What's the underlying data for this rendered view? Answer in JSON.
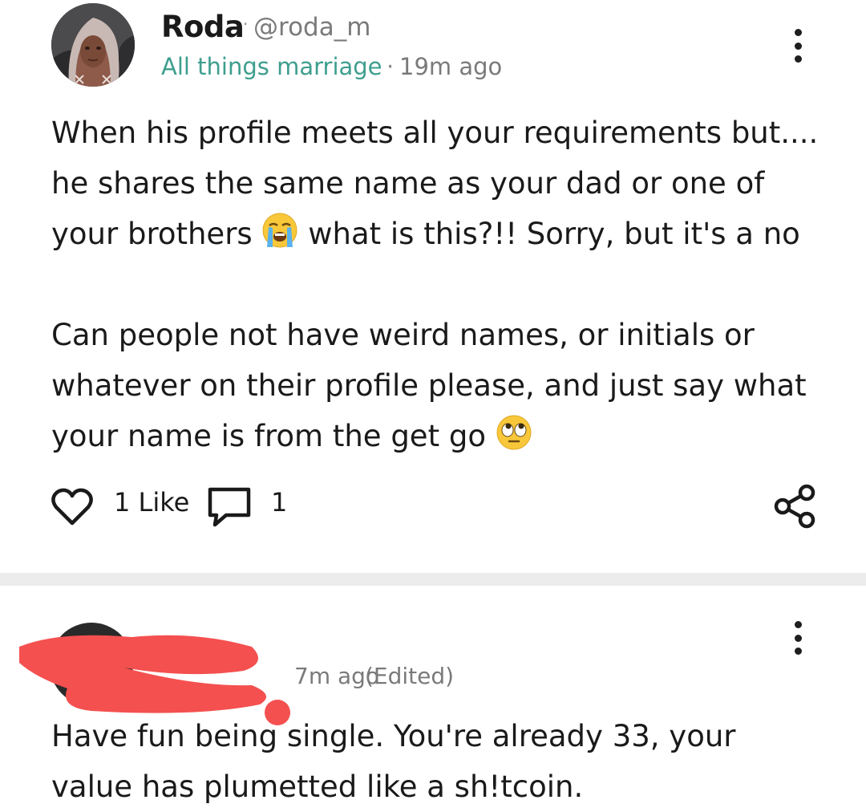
{
  "post": {
    "author": {
      "name": "Roda",
      "separator": "·",
      "handle": "@roda_m"
    },
    "group": {
      "name": "All things marriage",
      "separator": "·",
      "time": "19m ago"
    },
    "body": {
      "para1_a": "When his profile meets all your requirements but....",
      "para1_b": "he shares the same name as your dad or one of",
      "para1_c_before": "your brothers",
      "para1_c_emoji": "loudly-crying-face",
      "para1_c_after": "what is this?!! Sorry, but it's a no",
      "para2_a": "Can people not have weird names, or initials or",
      "para2_b": "whatever on their profile please, and just say what",
      "para2_c_before": "your name is from the get go",
      "para2_c_emoji": "face-with-rolling-eyes"
    },
    "actions": {
      "like_icon": "heart-outline-icon",
      "like_label": "1 Like",
      "comment_icon": "speech-bubble-icon",
      "comment_count": "1",
      "share_icon": "share-nodes-icon",
      "more_icon": "vertical-ellipsis-icon"
    }
  },
  "comment": {
    "time": "7m ago",
    "edited_label": "(Edited)",
    "more_icon": "vertical-ellipsis-icon",
    "body": {
      "line1": "Have fun being single. You're already 33, your",
      "line2": "value has plumetted like a sh!tcoin."
    }
  },
  "colors": {
    "group_accent": "#3e9e8e",
    "redaction": "#f4504f",
    "divider": "#ececec",
    "text": "#1a1a1a",
    "muted": "#7a7a7a"
  }
}
